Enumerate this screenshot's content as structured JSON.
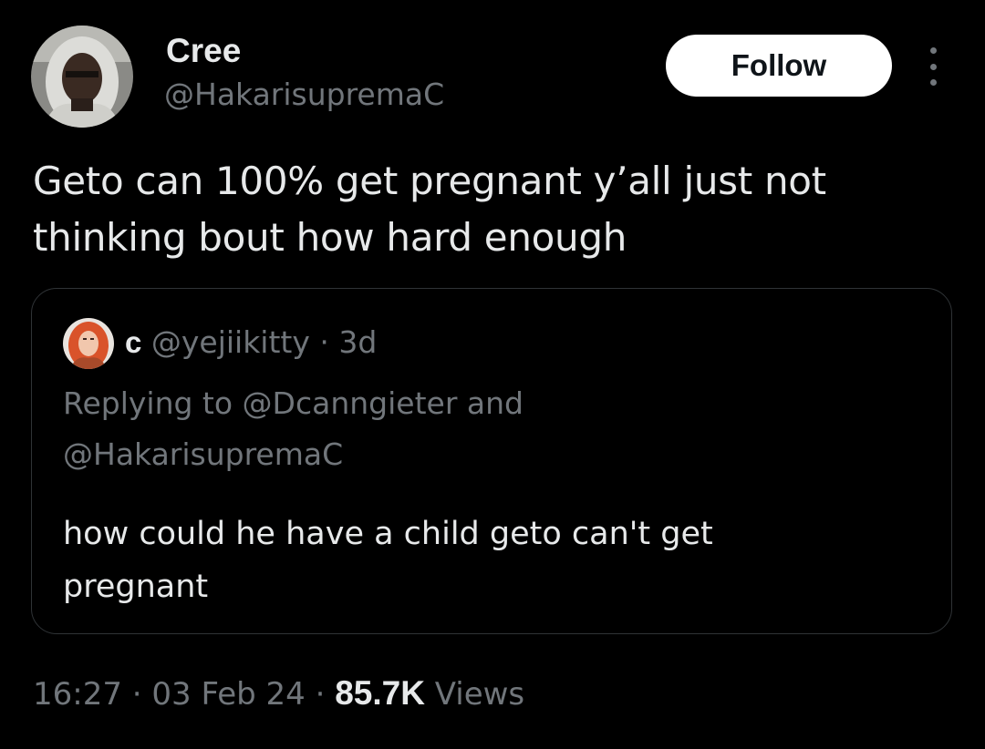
{
  "tweet": {
    "author": {
      "display_name": "Cree",
      "handle": "@HakarisupremaC"
    },
    "follow_label": "Follow",
    "text_line1": "Geto can 100% get pregnant y’all just not",
    "text_line2": "thinking bout how hard enough",
    "quote": {
      "display_name": "c",
      "handle": "@yejiikitty",
      "separator": "·",
      "time": "3d",
      "replying_prefix": "Replying to",
      "reply_mention_1": "@Dcanngieter",
      "reply_conjunction": "and",
      "reply_mention_2": "@HakarisupremaC",
      "text_line1": "how could he have a child geto can't get",
      "text_line2": "pregnant"
    },
    "meta": {
      "time": "16:27",
      "sep1": "·",
      "date": "03 Feb 24",
      "sep2": "·",
      "views_count": "85.7K",
      "views_label": "Views"
    }
  },
  "colors": {
    "background": "#000000",
    "primary_text": "#e7e9ea",
    "secondary_text": "#71767b",
    "border": "#2f3336",
    "follow_bg": "#ffffff"
  }
}
